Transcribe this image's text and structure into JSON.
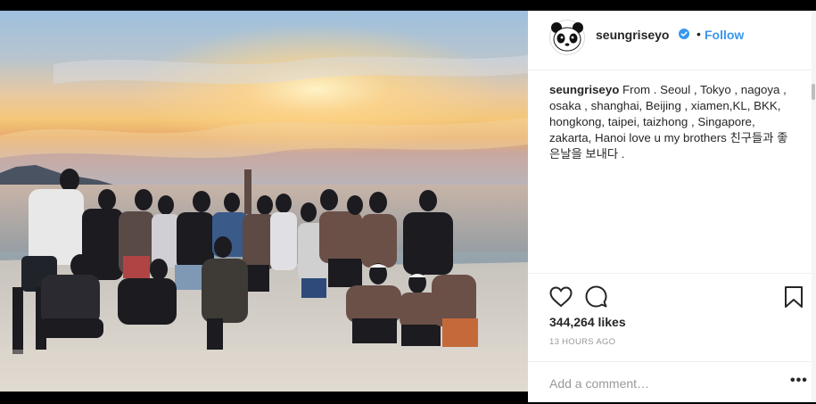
{
  "post": {
    "username": "seungriseyo",
    "follow_label": "Follow",
    "separator": "•",
    "caption_user": "seungriseyo",
    "caption_text": " From . Seoul , Tokyo , nagoya , osaka , shanghai, Beijing , xiamen,KL, BKK, hongkong, taipei, taizhong , Singapore, zakarta, Hanoi love u my brothers 친구들과 좋은날을 보내다 .",
    "likes": "344,264 likes",
    "time": "13 HOURS AGO",
    "comment_placeholder": "Add a comment…",
    "more_label": "•••"
  },
  "colors": {
    "accent": "#3897f0",
    "text": "#262626",
    "muted": "#999999",
    "border": "#efefef"
  },
  "icons": [
    "panda-avatar",
    "verified-badge-icon",
    "heart-icon",
    "comment-icon",
    "bookmark-icon",
    "more-options-icon"
  ]
}
